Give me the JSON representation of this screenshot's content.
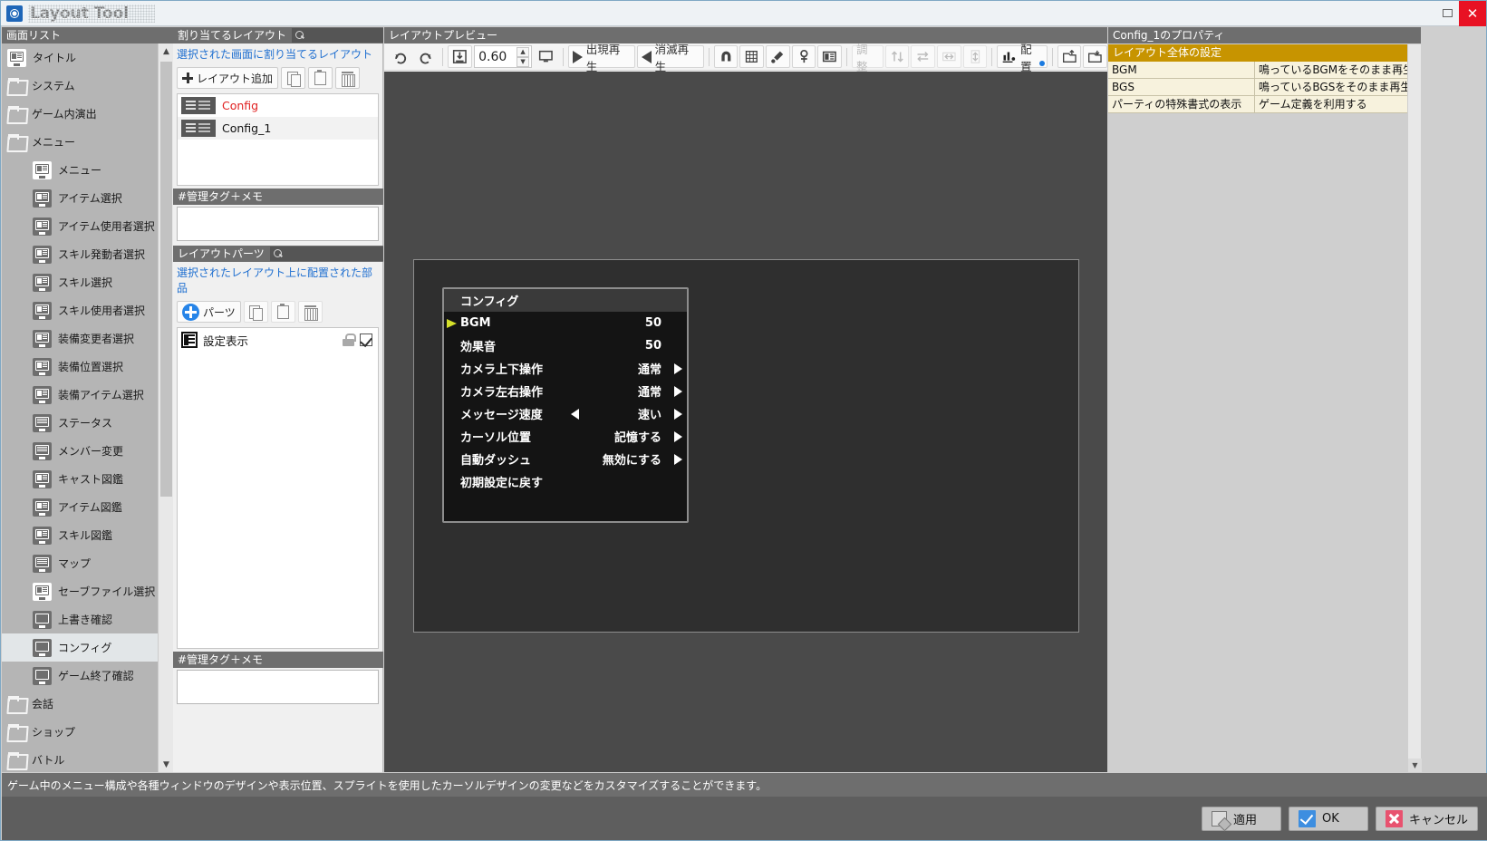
{
  "window": {
    "app_title": "Layout Tool",
    "logo_icon": "app-logo-icon",
    "maximize_icon": "maximize-icon",
    "close_icon": "close-icon"
  },
  "screen_list": {
    "header": "画面リスト",
    "items": [
      {
        "label": "タイトル",
        "icon": "screen-icon-light",
        "indent": 0,
        "selected": false
      },
      {
        "label": "システム",
        "icon": "folder-icon",
        "indent": 0,
        "selected": false
      },
      {
        "label": "ゲーム内演出",
        "icon": "folder-icon",
        "indent": 0,
        "selected": false
      },
      {
        "label": "メニュー",
        "icon": "folder-icon",
        "indent": 0,
        "selected": false
      },
      {
        "label": "メニュー",
        "icon": "screen-icon-light",
        "indent": 1,
        "selected": false
      },
      {
        "label": "アイテム選択",
        "icon": "screen-icon",
        "indent": 1,
        "selected": false
      },
      {
        "label": "アイテム使用者選択",
        "icon": "screen-icon",
        "indent": 1,
        "selected": false
      },
      {
        "label": "スキル発動者選択",
        "icon": "screen-icon",
        "indent": 1,
        "selected": false
      },
      {
        "label": "スキル選択",
        "icon": "screen-icon",
        "indent": 1,
        "selected": false
      },
      {
        "label": "スキル使用者選択",
        "icon": "screen-icon",
        "indent": 1,
        "selected": false
      },
      {
        "label": "装備変更者選択",
        "icon": "screen-icon",
        "indent": 1,
        "selected": false
      },
      {
        "label": "装備位置選択",
        "icon": "screen-icon",
        "indent": 1,
        "selected": false
      },
      {
        "label": "装備アイテム選択",
        "icon": "screen-icon",
        "indent": 1,
        "selected": false
      },
      {
        "label": "ステータス",
        "icon": "screen-icon-grid",
        "indent": 1,
        "selected": false
      },
      {
        "label": "メンバー変更",
        "icon": "screen-icon-grid",
        "indent": 1,
        "selected": false
      },
      {
        "label": "キャスト図鑑",
        "icon": "screen-icon",
        "indent": 1,
        "selected": false
      },
      {
        "label": "アイテム図鑑",
        "icon": "screen-icon",
        "indent": 1,
        "selected": false
      },
      {
        "label": "スキル図鑑",
        "icon": "screen-icon",
        "indent": 1,
        "selected": false
      },
      {
        "label": "マップ",
        "icon": "screen-icon-grid",
        "indent": 1,
        "selected": false
      },
      {
        "label": "セーブファイル選択",
        "icon": "screen-icon-light",
        "indent": 1,
        "selected": false
      },
      {
        "label": "上書き確認",
        "icon": "screen-icon-blank",
        "indent": 1,
        "selected": false
      },
      {
        "label": "コンフィグ",
        "icon": "screen-icon-blank",
        "indent": 1,
        "selected": true
      },
      {
        "label": "ゲーム終了確認",
        "icon": "screen-icon-blank",
        "indent": 1,
        "selected": false
      },
      {
        "label": "会話",
        "icon": "folder-icon",
        "indent": 0,
        "selected": false
      },
      {
        "label": "ショップ",
        "icon": "folder-icon",
        "indent": 0,
        "selected": false
      },
      {
        "label": "バトル",
        "icon": "folder-icon",
        "indent": 0,
        "selected": false
      }
    ],
    "scroll_up_icon": "chevron-up-icon",
    "scroll_down_icon": "chevron-down-icon"
  },
  "assign_layout": {
    "header": "割り当てるレイアウト",
    "search_icon": "search-icon",
    "search_value": "",
    "description": "選択された画面に割り当てるレイアウト",
    "toolbar": {
      "add_label": "レイアウト追加",
      "add_icon": "plus-icon",
      "copy_icon": "copy-icon",
      "paste_icon": "paste-icon",
      "delete_icon": "trash-icon"
    },
    "rows": [
      {
        "name": "Config",
        "icon": "layout-thumbnail",
        "highlight": true
      },
      {
        "name": "Config_1",
        "icon": "layout-thumbnail",
        "highlight": false
      }
    ],
    "memo_header": "#管理タグ＋メモ",
    "memo_value": ""
  },
  "layout_parts": {
    "header": "レイアウトパーツ",
    "search_icon": "search-icon",
    "search_value": "",
    "description": "選択されたレイアウト上に配置された部品",
    "toolbar": {
      "add_label": "パーツ",
      "add_icon": "circle-plus-icon",
      "copy_icon": "copy-icon",
      "paste_icon": "paste-icon",
      "delete_icon": "trash-icon"
    },
    "rows": [
      {
        "name": "設定表示",
        "icon": "part-icon",
        "lock_icon": "lock-icon",
        "visible_icon": "checkbox-icon"
      }
    ],
    "memo_header": "#管理タグ＋メモ",
    "memo_value": ""
  },
  "preview": {
    "header": "レイアウトプレビュー",
    "toolbar": {
      "redo_icon": "redo-icon",
      "undo_icon": "undo-icon",
      "fit_icon": "fit-to-screen-icon",
      "zoom_value": "0.60",
      "spin_up_icon": "spin-up-icon",
      "spin_down_icon": "spin-down-icon",
      "display_icon": "monitor-icon",
      "appear_play_label": "出現再生",
      "appear_play_icon": "play-icon",
      "vanish_play_label": "消滅再生",
      "vanish_play_icon": "play-reverse-icon",
      "magnet_icon": "magnet-icon",
      "grid_icon": "grid-icon",
      "eyedropper_icon": "eyedropper-icon",
      "pin_icon": "pin-icon",
      "layout-preview_icon": "layout-box-icon",
      "adjust_label": "調整",
      "align_v_icon": "align-vertical-icon",
      "swap_icon": "swap-horizontal-icon",
      "distribute_h_icon": "distribute-horizontal-icon",
      "distribute_v_icon": "distribute-vertical-icon",
      "arrange_label": "配置",
      "arrange_icon": "bar-chart-icon",
      "import_icon": "import-image-icon",
      "export_icon": "export-image-icon"
    }
  },
  "game_window": {
    "title": "コンフィグ",
    "cursor_icon": "cursor-arrow-icon",
    "rows": [
      {
        "label": "BGM",
        "value": "50",
        "cursor": true,
        "left_arrow": false,
        "right_arrow": false
      },
      {
        "label": "効果音",
        "value": "50",
        "cursor": false,
        "left_arrow": false,
        "right_arrow": false
      },
      {
        "label": "カメラ上下操作",
        "value": "通常",
        "cursor": false,
        "left_arrow": false,
        "right_arrow": true
      },
      {
        "label": "カメラ左右操作",
        "value": "通常",
        "cursor": false,
        "left_arrow": false,
        "right_arrow": true
      },
      {
        "label": "メッセージ速度",
        "value": "速い",
        "cursor": false,
        "left_arrow": true,
        "right_arrow": true
      },
      {
        "label": "カーソル位置",
        "value": "記憶する",
        "cursor": false,
        "left_arrow": false,
        "right_arrow": true
      },
      {
        "label": "自動ダッシュ",
        "value": "無効にする",
        "cursor": false,
        "left_arrow": false,
        "right_arrow": true
      },
      {
        "label": "初期設定に戻す",
        "value": "",
        "cursor": false,
        "left_arrow": false,
        "right_arrow": false
      }
    ]
  },
  "properties": {
    "header": "Config_1のプロパティ",
    "section": "レイアウト全体の設定",
    "rows": [
      {
        "key": "BGM",
        "value": "鳴っているBGMをそのまま再生する"
      },
      {
        "key": "BGS",
        "value": "鳴っているBGSをそのまま再生する"
      },
      {
        "key": "パーティの特殊書式の表示",
        "value": "ゲーム定義を利用する"
      }
    ],
    "scroll_down_icon": "chevron-down-icon"
  },
  "statusbar": {
    "text": "ゲーム中のメニュー構成や各種ウィンドウのデザインや表示位置、スプライトを使用したカーソルデザインの変更などをカスタマイズすることができます。"
  },
  "bottom_buttons": [
    {
      "label": "適用",
      "icon": "apply-icon"
    },
    {
      "label": "OK",
      "icon": "ok-check-icon"
    },
    {
      "label": "キャンセル",
      "icon": "cancel-x-icon"
    }
  ],
  "colors": {
    "accent_blue": "#1f6fd0",
    "highlight_red": "#e02020",
    "property_header": "#c79400",
    "property_bg": "#f7f2dd",
    "panel_header": "#6e6e6e"
  }
}
